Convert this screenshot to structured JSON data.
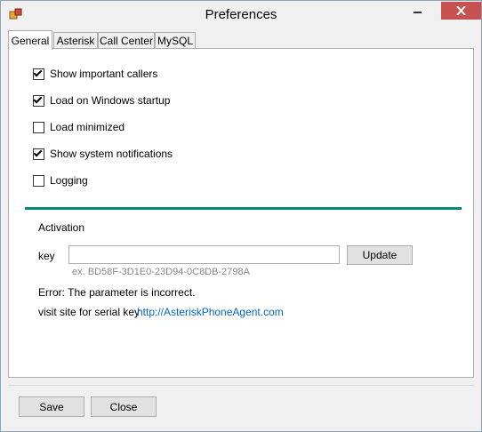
{
  "window": {
    "title": "Preferences"
  },
  "tabs": [
    {
      "label": "General",
      "active": true
    },
    {
      "label": "Asterisk",
      "active": false
    },
    {
      "label": "Call Center",
      "active": false
    },
    {
      "label": "MySQL",
      "active": false
    }
  ],
  "options": [
    {
      "label": "Show important callers",
      "checked": true
    },
    {
      "label": "Load on Windows startup",
      "checked": true
    },
    {
      "label": "Load minimized",
      "checked": false
    },
    {
      "label": "Show system notifications",
      "checked": true
    },
    {
      "label": "Logging",
      "checked": false
    }
  ],
  "activation": {
    "section_label": "Activation",
    "key_label": "key",
    "key_value": "",
    "update_label": "Update",
    "hint": "ex. BD58F-3D1E0-23D94-0C8DB-2798A",
    "error": "Error: The parameter is incorrect.",
    "visit_label": "visit site for serial key",
    "visit_link": "http://AsteriskPhoneAgent.com"
  },
  "footer": {
    "save_label": "Save",
    "close_label": "Close"
  },
  "colors": {
    "divider": "#00887a",
    "link": "#0066cc",
    "close_button": "#c75050"
  }
}
